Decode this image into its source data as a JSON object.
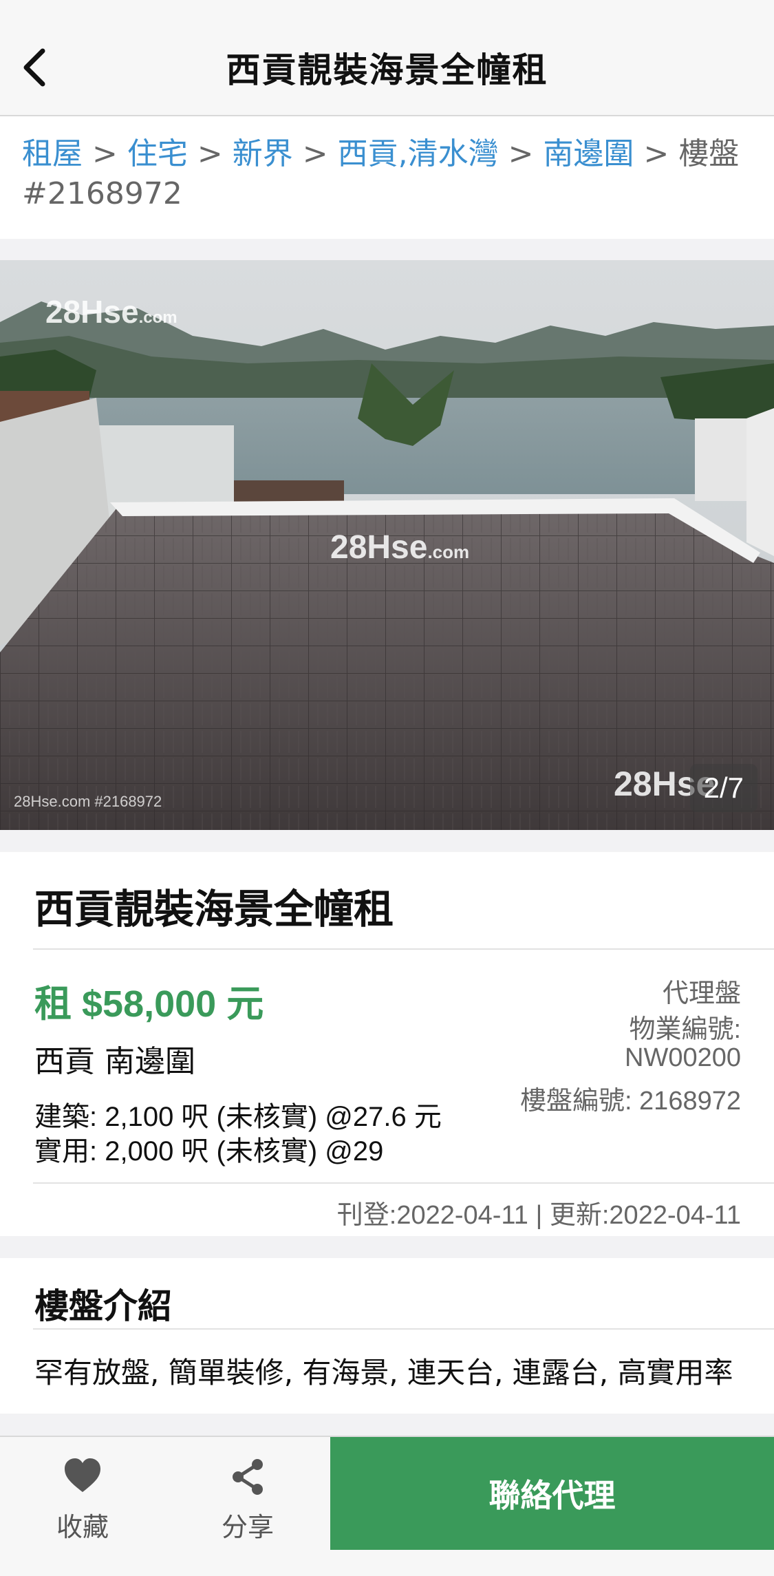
{
  "header": {
    "title": "西貢靚裝海景全幢租",
    "back_icon": "chevron-left-icon"
  },
  "breadcrumb": {
    "items": [
      "租屋",
      "住宅",
      "新界",
      "西貢,清水灣",
      "南邊圍"
    ],
    "separator": ">",
    "current": "樓盤 #2168972"
  },
  "gallery": {
    "watermark_main": "28Hse",
    "watermark_suffix": ".com",
    "caption": "28Hse.com #2168972",
    "counter": "2/7"
  },
  "listing": {
    "title": "西貢靚裝海景全幢租",
    "price": "租 $58,000 元",
    "district": "西貢 南邊圍",
    "gross_area": "建築: 2,100 呎 (未核實)  @27.6 元",
    "net_area": "實用: 2,000 呎 (未核實)  @29",
    "agent_type": "代理盤",
    "property_code_label": "物業編號:",
    "property_code": "NW00200",
    "listing_no": "樓盤編號: 2168972",
    "dates": "刊登:2022-04-11 | 更新:2022-04-11"
  },
  "intro": {
    "heading": "樓盤介紹",
    "text": "罕有放盤, 簡單裝修, 有海景, 連天台, 連露台, 高實用率"
  },
  "bottom_bar": {
    "favorite_label": "收藏",
    "favorite_icon": "heart-icon",
    "share_label": "分享",
    "share_icon": "share-icon",
    "contact_label": "聯絡代理"
  },
  "colors": {
    "accent_green": "#3a9a5a",
    "link_blue": "#3a8fd0"
  }
}
